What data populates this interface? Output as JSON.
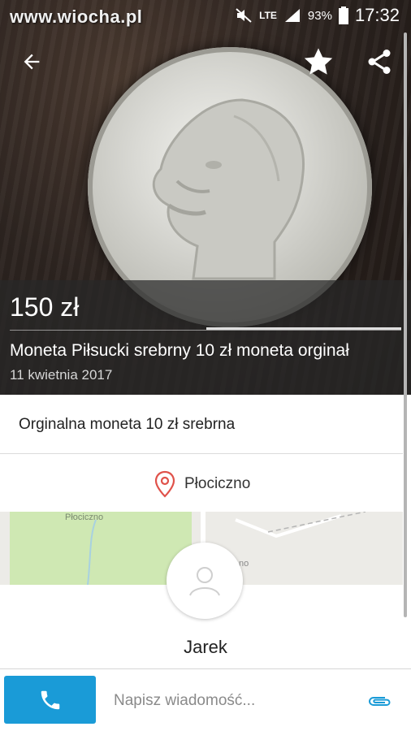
{
  "status_bar": {
    "watermark": "www.wiocha.pl",
    "network": "LTE",
    "battery": "93%",
    "time": "17:32"
  },
  "listing": {
    "price": "150 zł",
    "title": "Moneta Piłsucki srebrny 10 zł moneta orginał",
    "date": "11 kwietnia 2017",
    "description": "Orginalna moneta 10 zł srebrna",
    "location": "Płociczno",
    "map_label": "Płociczno",
    "map_label_partial": "no",
    "photo_progress": 0.5
  },
  "seller": {
    "name": "Jarek"
  },
  "message_bar": {
    "placeholder": "Napisz wiadomość..."
  },
  "colors": {
    "accent": "#1a9bd7",
    "pin": "#e0524a",
    "map_green": "#cfe8b3"
  },
  "icons": [
    "back-arrow-icon",
    "star-icon",
    "share-icon",
    "location-pin-icon",
    "avatar-placeholder-icon",
    "phone-icon",
    "paperclip-icon",
    "mute-icon",
    "signal-icon",
    "battery-icon"
  ]
}
